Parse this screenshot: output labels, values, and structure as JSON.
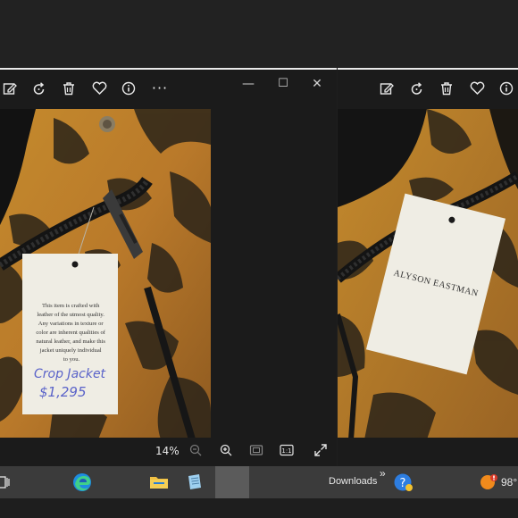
{
  "left_window": {
    "toolbar": {
      "edit_icon": "edit-image-icon",
      "rotate_icon": "rotate-icon",
      "delete_icon": "delete-icon",
      "favorite_icon": "heart-icon",
      "info_icon": "info-icon",
      "more_label": "···"
    },
    "caption": {
      "minimize": "—",
      "maximize": "☐",
      "close": "✕"
    },
    "photo": {
      "tag_text": [
        "This item is crafted with",
        "leather of the utmost quality.",
        "Any variations in texture or",
        "color are inherent qualities of",
        "natural leather, and make this",
        "jacket uniquely individual",
        "to you."
      ],
      "handwritten_name": "Crop Jacket",
      "handwritten_price": "$1,295"
    },
    "status": {
      "zoom": "14%"
    }
  },
  "right_window": {
    "toolbar": {
      "edit_icon": "edit-image-icon",
      "rotate_icon": "rotate-icon",
      "delete_icon": "delete-icon",
      "favorite_icon": "heart-icon",
      "info_icon": "info-icon"
    },
    "photo": {
      "tag_brand": "ALYSON EASTMAN"
    }
  },
  "taskbar": {
    "downloads_label": "Downloads",
    "overflow": "»",
    "temperature": "98°"
  },
  "colors": {
    "leather_gold": "#c98d2e",
    "leather_dark": "#2a2418",
    "tag_paper": "#efede4",
    "window_bg": "#1b1b1b",
    "taskbar_bg": "#3b3b3b"
  }
}
